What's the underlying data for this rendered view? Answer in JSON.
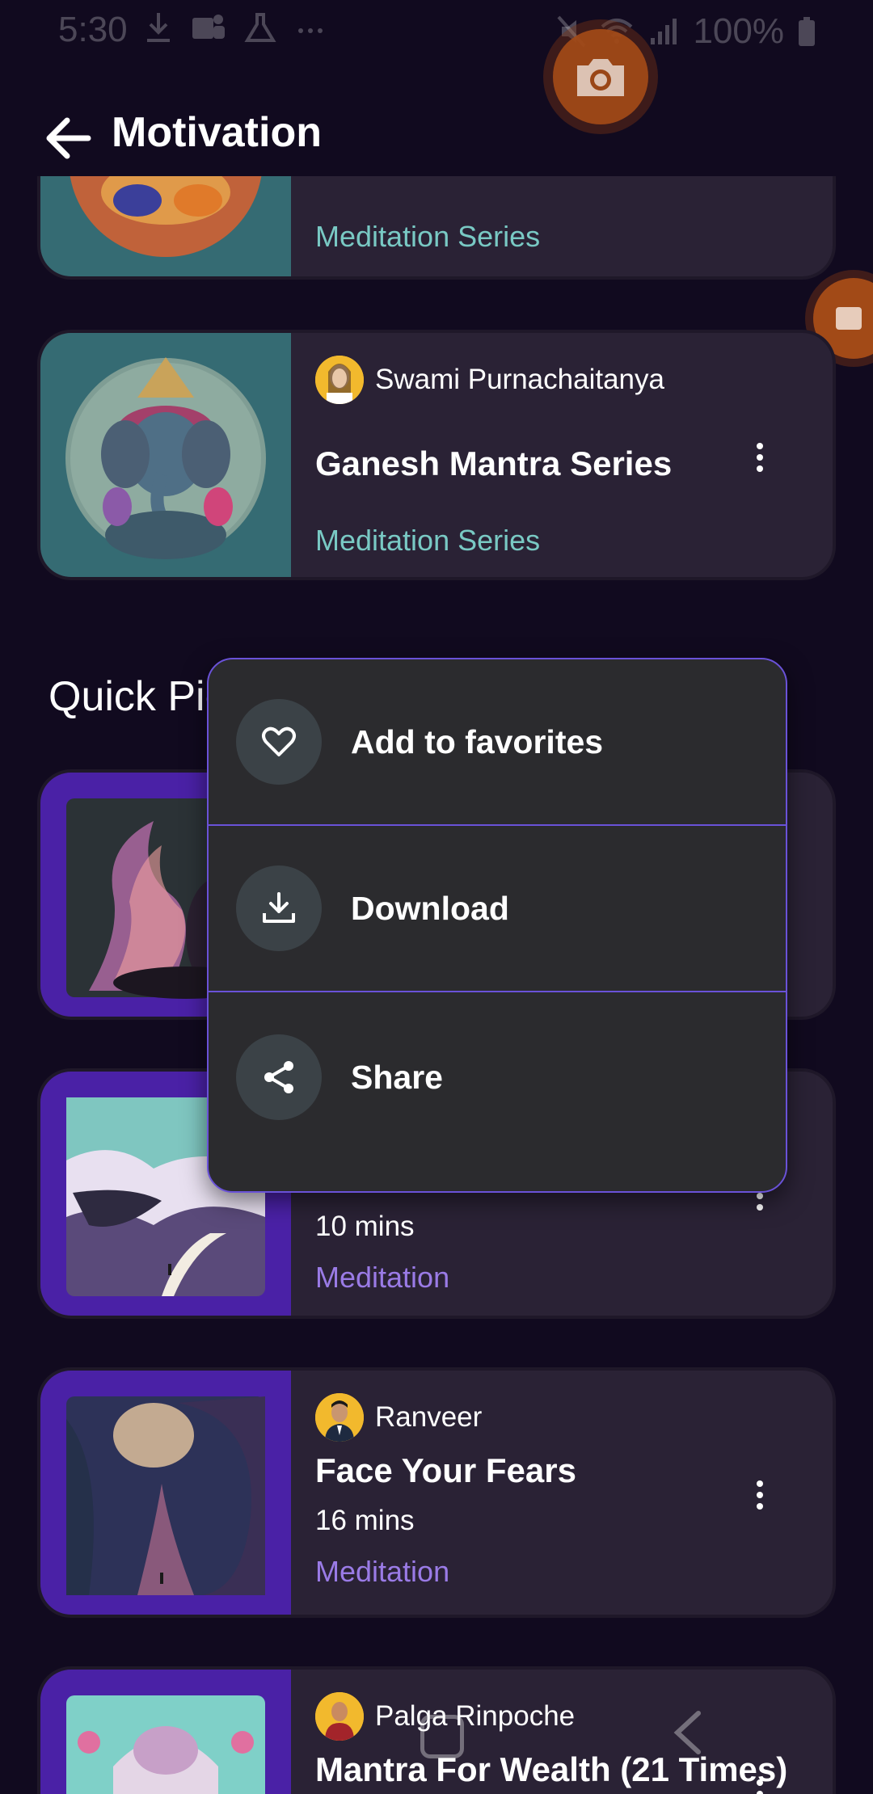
{
  "status_bar": {
    "time": "5:30",
    "battery": "100%",
    "icons_left": [
      "download-icon",
      "teams-icon",
      "flask-icon",
      "more-icon"
    ],
    "icons_right": [
      "mute-icon",
      "wifi-icon",
      "signal-icon",
      "battery-icon"
    ]
  },
  "header": {
    "title": "Motivation",
    "back_icon": "arrow-left-icon",
    "camera_icon": "camera-icon",
    "video_icon": "video-icon"
  },
  "cards_top": [
    {
      "category": "Meditation Series"
    },
    {
      "author": "Swami Purnachaitanya",
      "title": "Ganesh Mantra Series",
      "category": "Meditation Series"
    }
  ],
  "section": {
    "title": "Quick Picks"
  },
  "cards_bottom": [
    {
      "duration": "10 mins",
      "category": "Meditation"
    },
    {
      "author": "Ranveer",
      "title": "Face Your Fears",
      "duration": "16 mins",
      "category": "Meditation"
    },
    {
      "author": "Palga Rinpoche",
      "title": "Mantra For Wealth (21 Times)"
    }
  ],
  "popup_menu": {
    "items": [
      {
        "label": "Add to favorites",
        "icon": "heart-icon"
      },
      {
        "label": "Download",
        "icon": "download-icon"
      },
      {
        "label": "Share",
        "icon": "share-icon"
      }
    ]
  },
  "colors": {
    "background": "#110a1f",
    "card": "#2a2235",
    "teal_accent": "#79c9c4",
    "purple_accent": "#9a7be6",
    "popup_border": "#6a52d8"
  }
}
